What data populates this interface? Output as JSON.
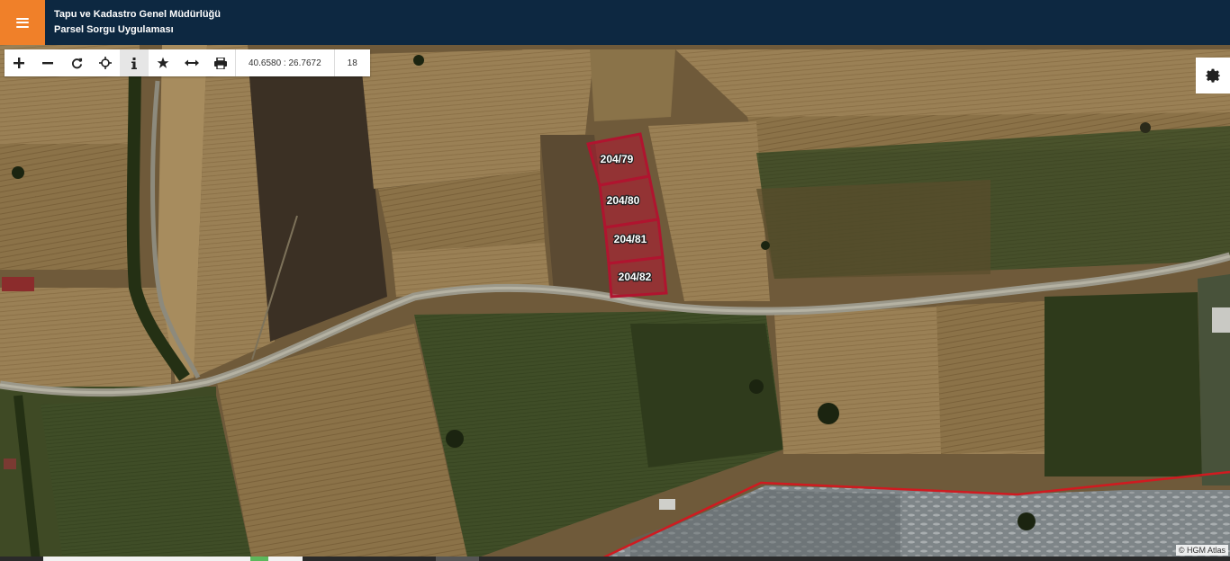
{
  "header": {
    "title_line1": "Tapu ve Kadastro Genel Müdürlüğü",
    "title_line2": "Parsel Sorgu Uygulaması",
    "menu_icon": "hamburger-icon",
    "accent_color": "#f08029",
    "bar_color": "#0d2841"
  },
  "toolbar": {
    "tools": [
      {
        "name": "zoom-in",
        "icon": "plus-icon"
      },
      {
        "name": "zoom-out",
        "icon": "minus-icon"
      },
      {
        "name": "refresh",
        "icon": "refresh-icon"
      },
      {
        "name": "locate",
        "icon": "crosshair-icon"
      },
      {
        "name": "info",
        "icon": "info-icon"
      },
      {
        "name": "favorite",
        "icon": "star-icon"
      },
      {
        "name": "measure",
        "icon": "measure-icon"
      },
      {
        "name": "print",
        "icon": "print-icon"
      }
    ],
    "coordinates": "40.6580 : 26.7672",
    "zoom_level": "18"
  },
  "settings": {
    "icon": "gear-icon"
  },
  "map": {
    "parcels": [
      {
        "label": "204/79"
      },
      {
        "label": "204/80"
      },
      {
        "label": "204/81"
      },
      {
        "label": "204/82"
      }
    ],
    "parcel_color": "#b0142f",
    "boundary_color": "#d01a20"
  },
  "attribution": "© HGM Atlas"
}
